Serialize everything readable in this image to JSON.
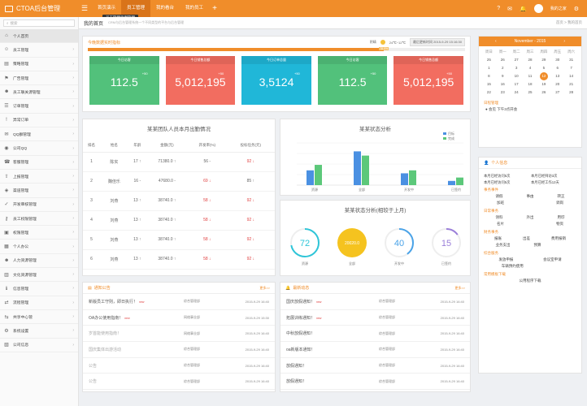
{
  "app": {
    "title": "CTOA后台管理"
  },
  "top_nav": [
    "首页演示",
    "员工管理",
    "我的看台",
    "我的员工"
  ],
  "tooltip": "员工管理示例管理",
  "user": {
    "name": "我的之家"
  },
  "search": {
    "placeholder": "搜索"
  },
  "sidebar": {
    "items": [
      {
        "label": "个人首页",
        "icon": "home-icon"
      },
      {
        "label": "员工管理",
        "icon": "user-icon"
      },
      {
        "label": "策略管理",
        "icon": "doc-icon"
      },
      {
        "label": "广告管理",
        "icon": "flag-icon"
      },
      {
        "label": "员工联关源管理",
        "icon": "users-icon"
      },
      {
        "label": "订单管理",
        "icon": "list-icon"
      },
      {
        "label": "异常订单",
        "icon": "alert-icon"
      },
      {
        "label": "QQ群管理",
        "icon": "chat-icon"
      },
      {
        "label": "公司QQ",
        "icon": "qq-icon"
      },
      {
        "label": "客服管理",
        "icon": "phone-icon"
      },
      {
        "label": "上报管理",
        "icon": "upload-icon"
      },
      {
        "label": "渠道管理",
        "icon": "channel-icon"
      },
      {
        "label": "开发审核管理",
        "icon": "check-icon"
      },
      {
        "label": "员工权限管理",
        "icon": "key-icon"
      },
      {
        "label": "权限管理",
        "icon": "lock-icon"
      },
      {
        "label": "个人办公",
        "icon": "briefcase-icon"
      },
      {
        "label": "人力资源管理",
        "icon": "people-icon"
      },
      {
        "label": "文化资源管理",
        "icon": "book-icon"
      },
      {
        "label": "信息管理",
        "icon": "info-icon"
      },
      {
        "label": "流程管理",
        "icon": "flow-icon"
      },
      {
        "label": "共享中心管",
        "icon": "share-icon"
      },
      {
        "label": "系统设置",
        "icon": "gear-icon"
      },
      {
        "label": "公司信息",
        "icon": "building-icon"
      }
    ]
  },
  "breadcrumb": {
    "title": "我的首页",
    "subtitle": "CRM与后台管理系统一个不同类型的平台与后台管理",
    "path": "首页 > 我的首页"
  },
  "kpi": {
    "title": "今晚数据实时指标",
    "weather": "阴晴",
    "temp": "24℃~12℃",
    "date": "最后更新时间  2015-9-29 15:16:30",
    "progress_pct": "78.5%",
    "cards": [
      {
        "label": "今日访客",
        "value": "112.5",
        "delta": "+50",
        "color": "#52c17b"
      },
      {
        "label": "今日销售总额",
        "value": "5,012,195",
        "delta": "+50",
        "color": "#f26d60"
      },
      {
        "label": "今日订单总量",
        "value": "3,5124",
        "delta": "+50",
        "color": "#20b7d8"
      },
      {
        "label": "今日访客",
        "value": "112.5",
        "delta": "+50",
        "color": "#52c17b"
      },
      {
        "label": "今日销售总额",
        "value": "5,012,195",
        "delta": "+50",
        "color": "#f26d60"
      }
    ]
  },
  "attendance": {
    "title": "某某团队人员本月出勤情况",
    "headers": [
      "排名",
      "姓名",
      "年龄",
      "金额(元)",
      "开发率(%)",
      "投标任务(元)"
    ],
    "rows": [
      [
        "1",
        "陈实",
        "17 ↑",
        "71380.0 ↑",
        "56 -",
        "92 ↓"
      ],
      [
        "2",
        "魏佳乐",
        "16 -",
        "47680.0 -",
        "69 ↓",
        "85 ↑"
      ],
      [
        "3",
        "刘燕",
        "13 ↑",
        "38740.0 ↑",
        "58 ↓",
        "92 ↓"
      ],
      [
        "4",
        "刘燕",
        "13 ↑",
        "38740.0 ↑",
        "58 ↓",
        "92 ↓"
      ],
      [
        "5",
        "刘燕",
        "13 ↑",
        "38740.0 ↑",
        "58 ↓",
        "92 ↓"
      ],
      [
        "6",
        "刘燕",
        "13 ↑",
        "38740.0 ↑",
        "58 ↓",
        "92 ↓"
      ]
    ]
  },
  "bar_chart": {
    "title": "某某状态分析",
    "legend": [
      "目标",
      "完成"
    ],
    "colors": [
      "#4a90e2",
      "#5cc87a"
    ]
  },
  "chart_data": {
    "type": "bar",
    "categories": [
      "资源",
      "全部",
      "开发中",
      "已签约"
    ],
    "series": [
      {
        "name": "目标",
        "values": [
          35,
          80,
          28,
          10
        ]
      },
      {
        "name": "完成",
        "values": [
          48,
          70,
          35,
          18
        ]
      }
    ],
    "ylim": [
      0,
      100
    ]
  },
  "donuts": {
    "title": "某某状态分析(相较于上月)",
    "items": [
      {
        "value": "72",
        "label": "资源",
        "color": "#2ec5d8",
        "pct": 0.72
      },
      {
        "value": "20020.0",
        "label": "全部",
        "color": "#f5c31f",
        "pct": 1.0
      },
      {
        "value": "40",
        "label": "开发中",
        "color": "#4aa3e8",
        "pct": 0.4
      },
      {
        "value": "15",
        "label": "已签约",
        "color": "#9b7fd9",
        "pct": 0.15
      }
    ]
  },
  "notices": {
    "title": "通知公告",
    "more": "更多>>",
    "rows": [
      [
        "新版员工守则，即日执行！",
        "new",
        "综合管理部",
        "2015-9-29 16:40"
      ],
      [
        "OA办公使用指南！",
        "new",
        "网络事业部",
        "2015-9-29 15:30"
      ],
      [
        "岁首能使用指南！",
        "",
        "网络事业部",
        "2015-9-29 16:40"
      ],
      [
        "国庆集体出游活动",
        "",
        "综合管理部",
        "2015-9-29 16:40"
      ],
      [
        "公告",
        "",
        "综合管理部",
        "2015-9-29 16:40"
      ],
      [
        "公告",
        "",
        "综合管理部",
        "2015-9-29 16:40"
      ]
    ]
  },
  "news": {
    "title": "最新动态",
    "more": "更多>>",
    "rows": [
      [
        "国庆放假通知！",
        "new",
        "综合管理部",
        "2015-9-29 16:40"
      ],
      [
        "拓展训练通知！",
        "new",
        "综合管理部",
        "2015-9-29 16:40"
      ],
      [
        "中秋放假通知！",
        "",
        "综合管理部",
        "2015-9-29 16:40"
      ],
      [
        "oa新版本通知！",
        "",
        "综合管理部",
        "2015-9-29 16:40"
      ],
      [
        "放假通知！",
        "",
        "综合管理部",
        "2015-9-29 16:40"
      ],
      [
        "放假通知！",
        "",
        "综合管理部",
        "2015-9-29 16:40"
      ]
    ]
  },
  "calendar": {
    "title": "November - 2015",
    "weekdays": [
      "周日",
      "周一",
      "周二",
      "周三",
      "周四",
      "周五",
      "周六"
    ],
    "days": [
      "25",
      "26",
      "27",
      "28",
      "29",
      "30",
      "31",
      "1",
      "2",
      "3",
      "4",
      "5",
      "6",
      "7",
      "8",
      "9",
      "10",
      "11",
      "12",
      "13",
      "14",
      "15",
      "16",
      "17",
      "18",
      "19",
      "20",
      "21",
      "22",
      "23",
      "24",
      "25",
      "26",
      "27",
      "28"
    ],
    "selected": "12",
    "agenda_title": "日程管理",
    "agenda": "● 会见    下午3点开会"
  },
  "personal": {
    "title": "个人信息",
    "stats": [
      "本月已经访问5次",
      "本月已经拜访3次",
      "本月已经访问5次",
      "本月已经工作12天"
    ],
    "sections": [
      {
        "title": "事务事件",
        "rows": [
          [
            "请假",
            "事由",
            "转正"
          ],
          [
            "加班",
            "",
            "调岗"
          ]
        ]
      },
      {
        "title": "日常事务",
        "rows": [
          [
            "领料",
            "外出",
            "用印"
          ],
          [
            "名片",
            "",
            "物资"
          ]
        ]
      },
      {
        "title": "财务事务",
        "rows": [
          [
            "报账",
            "出差",
            "费用报销"
          ],
          [
            "业务支出",
            "预算",
            ""
          ]
        ]
      },
      {
        "title": "综合服务",
        "rows": [
          [
            "发放申报",
            "会议室申请"
          ],
          [
            "车辆预约使用",
            ""
          ]
        ]
      },
      {
        "title": "常用模板下载",
        "rows": [
          [
            "公用程序下载"
          ]
        ]
      }
    ]
  }
}
